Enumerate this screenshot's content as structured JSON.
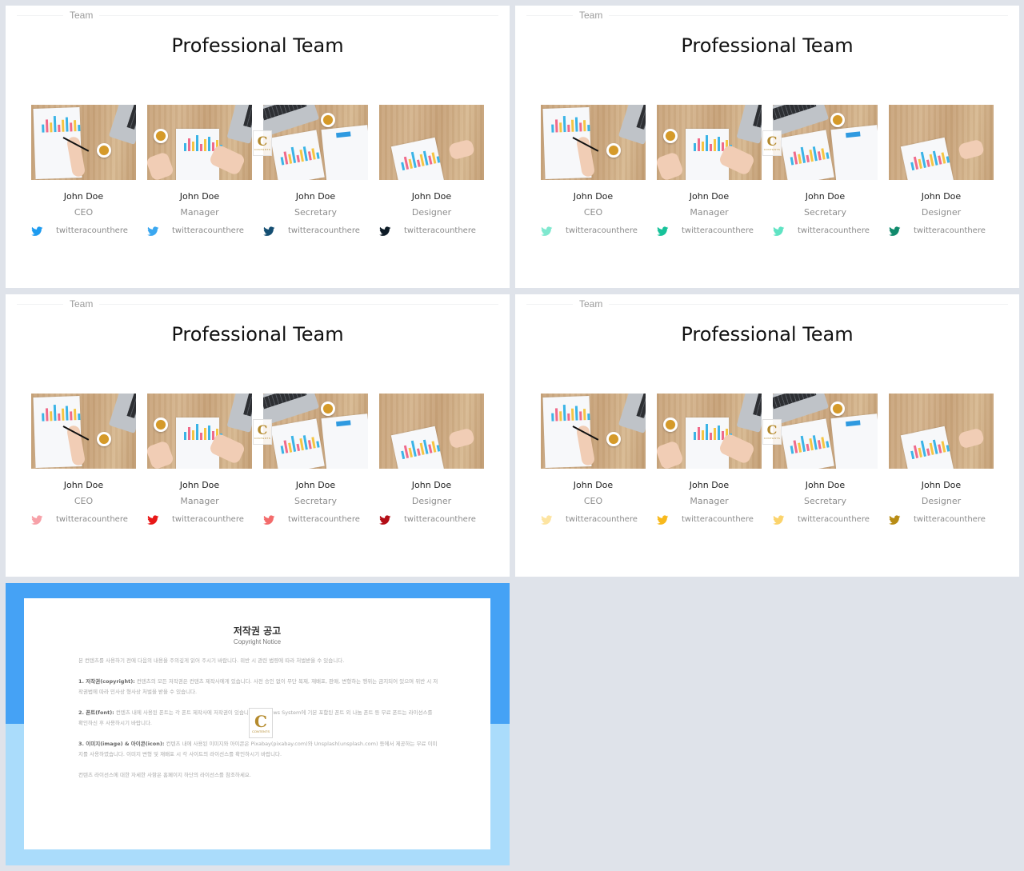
{
  "slides": [
    {
      "section_label": "Team",
      "title": "Professional Team",
      "members": [
        {
          "name": "John Doe",
          "role": "CEO",
          "handle": "twitteracounthere",
          "icon": "twitter-icon",
          "icon_color": "#1d9bf0"
        },
        {
          "name": "John Doe",
          "role": "Manager",
          "handle": "twitteracounthere",
          "icon": "twitter-icon",
          "icon_color": "#3aa7f0"
        },
        {
          "name": "John Doe",
          "role": "Secretary",
          "handle": "twitteracounthere",
          "icon": "twitter-icon",
          "icon_color": "#144e72"
        },
        {
          "name": "John Doe",
          "role": "Designer",
          "handle": "twitteracounthere",
          "icon": "twitter-icon",
          "icon_color": "#0d1b26"
        }
      ]
    },
    {
      "section_label": "Team",
      "title": "Professional Team",
      "members": [
        {
          "name": "John Doe",
          "role": "CEO",
          "handle": "twitteracounthere",
          "icon": "twitter-icon",
          "icon_color": "#7fe8cf"
        },
        {
          "name": "John Doe",
          "role": "Manager",
          "handle": "twitteracounthere",
          "icon": "twitter-icon",
          "icon_color": "#17c29a"
        },
        {
          "name": "John Doe",
          "role": "Secretary",
          "handle": "twitteracounthere",
          "icon": "twitter-icon",
          "icon_color": "#5fe3c3"
        },
        {
          "name": "John Doe",
          "role": "Designer",
          "handle": "twitteracounthere",
          "icon": "twitter-icon",
          "icon_color": "#108a6c"
        }
      ]
    },
    {
      "section_label": "Team",
      "title": "Professional Team",
      "members": [
        {
          "name": "John Doe",
          "role": "CEO",
          "handle": "twitteracounthere",
          "icon": "twitter-icon",
          "icon_color": "#f7a1a8"
        },
        {
          "name": "John Doe",
          "role": "Manager",
          "handle": "twitteracounthere",
          "icon": "twitter-icon",
          "icon_color": "#e81818"
        },
        {
          "name": "John Doe",
          "role": "Secretary",
          "handle": "twitteracounthere",
          "icon": "twitter-icon",
          "icon_color": "#f36b6b"
        },
        {
          "name": "John Doe",
          "role": "Designer",
          "handle": "twitteracounthere",
          "icon": "twitter-icon",
          "icon_color": "#b30d16"
        }
      ]
    },
    {
      "section_label": "Team",
      "title": "Professional Team",
      "members": [
        {
          "name": "John Doe",
          "role": "CEO",
          "handle": "twitteracounthere",
          "icon": "twitter-icon",
          "icon_color": "#fde4a1"
        },
        {
          "name": "John Doe",
          "role": "Manager",
          "handle": "twitteracounthere",
          "icon": "twitter-icon",
          "icon_color": "#f8b91c"
        },
        {
          "name": "John Doe",
          "role": "Secretary",
          "handle": "twitteracounthere",
          "icon": "twitter-icon",
          "icon_color": "#fbd36b"
        },
        {
          "name": "John Doe",
          "role": "Designer",
          "handle": "twitteracounthere",
          "icon": "twitter-icon",
          "icon_color": "#b88c14"
        }
      ]
    }
  ],
  "watermark": {
    "letter": "C",
    "text": "CONTENTS"
  },
  "copyright": {
    "title": "저작권 공고",
    "subtitle": "Copyright Notice",
    "intro": "본 컨텐츠를 사용하기 전에 다음의 내용을 주의깊게 읽어 주시기 바랍니다. 위반 시 관련 법령에 따라 처벌받을 수 있습니다.",
    "sections": [
      {
        "heading": "1. 저작권(copyright):",
        "text": "컨텐츠의 모든 저작권은 컨텐츠 제작사에게 있습니다. 사전 승인 없이 무단 복제, 재배포, 판매, 변형하는 행위는 금지되어 있으며 위반 시 저작권법에 따라 민사상 형사상 처벌을 받을 수 있습니다."
      },
      {
        "heading": "2. 폰트(font):",
        "text": "컨텐츠 내에 사용된 폰트는 각 폰트 제작사에 저작권이 있습니다. Windows System에 기본 포함된 폰트 외 나눔 폰트 등 무료 폰트는 라이선스를 확인하신 후 사용하시기 바랍니다."
      },
      {
        "heading": "3. 이미지(image) & 아이콘(icon):",
        "text": "컨텐츠 내에 사용된 이미지와 아이콘은 Pixabay(pixabay.com)와 Unsplash(unsplash.com) 등에서 제공하는 무료 이미지를 사용하였습니다. 이미지 변형 및 재배포 시 각 사이트의 라이선스를 확인하시기 바랍니다."
      }
    ],
    "footer": "컨텐츠 라이선스에 대한 자세한 사항은 홈페이지 하단의 라이선스를 참조하세요."
  }
}
